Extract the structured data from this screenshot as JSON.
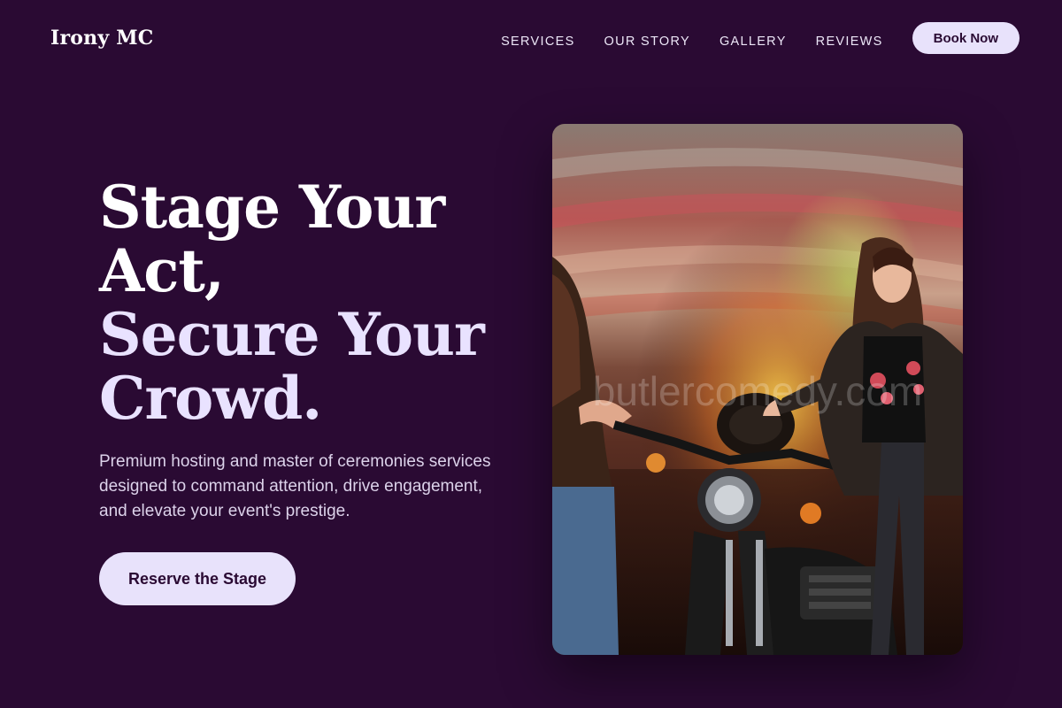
{
  "brand": {
    "name": "Irony MC"
  },
  "nav": {
    "links": [
      "SERVICES",
      "OUR STORY",
      "GALLERY",
      "REVIEWS"
    ],
    "book_label": "Book Now"
  },
  "hero": {
    "title_lines": [
      "Stage Your",
      "Act,",
      "Secure Your",
      "Crowd."
    ],
    "subtitle": "Premium hosting and master of ceremonies services designed to command attention, drive engagement, and elevate your event's prestige.",
    "cta_label": "Reserve the Stage"
  },
  "photo": {
    "description_icon": "photo-illustration",
    "watermark": "butlercomedy.com"
  },
  "colors": {
    "background": "#2a0a33",
    "button_bg": "#e8e2fb",
    "button_text": "#2a0a33",
    "title_accent": "#e9e2ff"
  }
}
